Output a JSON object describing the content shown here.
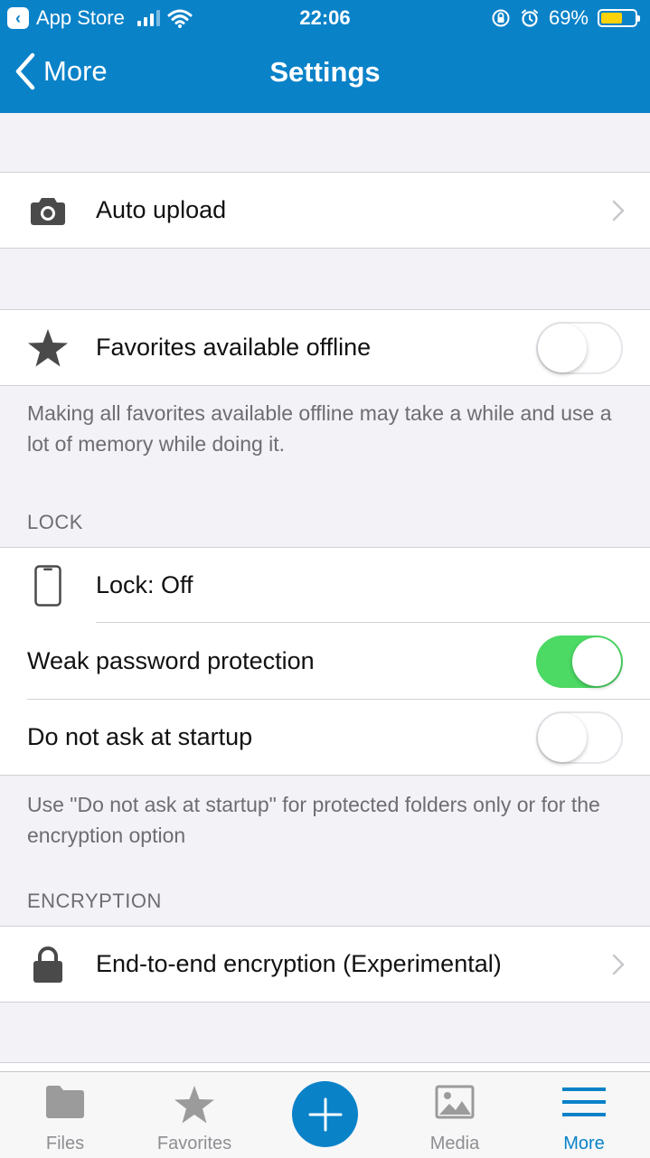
{
  "status_bar": {
    "back_app": "App Store",
    "time": "22:06",
    "battery": "69%",
    "battery_level": 0.69
  },
  "nav": {
    "back_label": "More",
    "title": "Settings"
  },
  "auto_upload": {
    "label": "Auto upload",
    "icon": "camera-icon"
  },
  "favorites_offline": {
    "label": "Favorites available offline",
    "icon": "star-icon",
    "enabled": false,
    "note": "Making all favorites available offline may take a while and use a lot of memory while doing it."
  },
  "lock_section": {
    "header": "LOCK",
    "lock_label": "Lock: Off",
    "weak_password_label": "Weak password protection",
    "weak_password_enabled": true,
    "do_not_ask_label": "Do not ask at startup",
    "do_not_ask_enabled": false,
    "note": "Use \"Do not ask at startup\" for protected folders only or for the encryption option"
  },
  "encryption_section": {
    "header": "ENCRYPTION",
    "e2e_label": "End-to-end encryption (Experimental)"
  },
  "tabbar": {
    "files": "Files",
    "favorites": "Favorites",
    "media": "Media",
    "more": "More",
    "active": "More"
  },
  "colors": {
    "brand": "#0a82c8",
    "toggle_on": "#4cd964",
    "battery": "#ffd20a"
  }
}
